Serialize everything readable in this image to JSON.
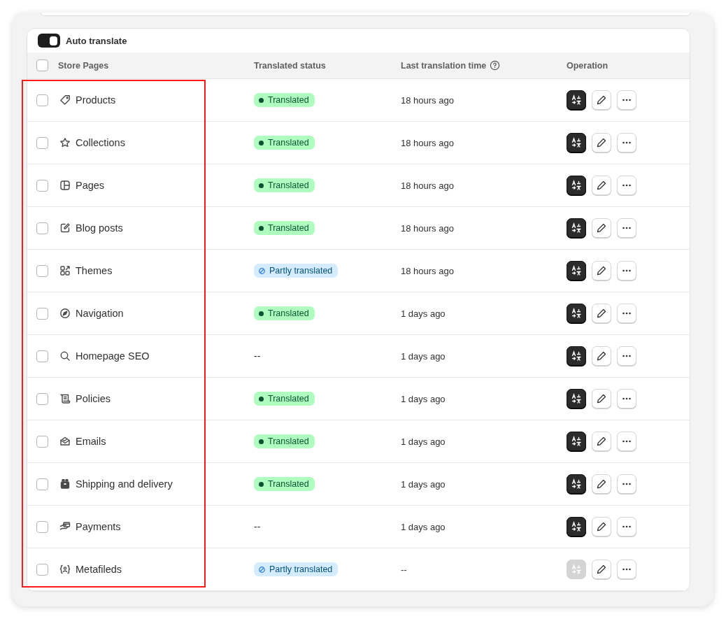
{
  "auto_translate": {
    "label": "Auto translate",
    "on": true
  },
  "table": {
    "columns": [
      "Store Pages",
      "Translated status",
      "Last translation time",
      "Operation"
    ],
    "header_checked": false,
    "rows": [
      {
        "kind": "tag",
        "name": "Products",
        "checked": false,
        "status": {
          "kind": "translated",
          "label": "Translated"
        },
        "time": "18 hours ago",
        "translate_enabled": true
      },
      {
        "kind": "star",
        "name": "Collections",
        "checked": false,
        "status": {
          "kind": "translated",
          "label": "Translated"
        },
        "time": "18 hours ago",
        "translate_enabled": true
      },
      {
        "kind": "layout",
        "name": "Pages",
        "checked": false,
        "status": {
          "kind": "translated",
          "label": "Translated"
        },
        "time": "18 hours ago",
        "translate_enabled": true
      },
      {
        "kind": "edit",
        "name": "Blog posts",
        "checked": false,
        "status": {
          "kind": "translated",
          "label": "Translated"
        },
        "time": "18 hours ago",
        "translate_enabled": true
      },
      {
        "kind": "apps",
        "name": "Themes",
        "checked": false,
        "status": {
          "kind": "partial",
          "label": "Partly translated"
        },
        "time": "18 hours ago",
        "translate_enabled": true
      },
      {
        "kind": "compass",
        "name": "Navigation",
        "checked": false,
        "status": {
          "kind": "translated",
          "label": "Translated"
        },
        "time": "1 days ago",
        "translate_enabled": true
      },
      {
        "kind": "search",
        "name": "Homepage SEO",
        "checked": false,
        "status": {
          "kind": "none",
          "label": "--"
        },
        "time": "1 days ago",
        "translate_enabled": true
      },
      {
        "kind": "scroll",
        "name": "Policies",
        "checked": false,
        "status": {
          "kind": "translated",
          "label": "Translated"
        },
        "time": "1 days ago",
        "translate_enabled": true
      },
      {
        "kind": "mail",
        "name": "Emails",
        "checked": false,
        "status": {
          "kind": "translated",
          "label": "Translated"
        },
        "time": "1 days ago",
        "translate_enabled": true
      },
      {
        "kind": "box",
        "name": "Shipping and delivery",
        "checked": false,
        "status": {
          "kind": "translated",
          "label": "Translated"
        },
        "time": "1 days ago",
        "translate_enabled": true
      },
      {
        "kind": "hand",
        "name": "Payments",
        "checked": false,
        "status": {
          "kind": "none",
          "label": "--"
        },
        "time": "1 days ago",
        "translate_enabled": true
      },
      {
        "kind": "metafield",
        "name": "Metafileds",
        "checked": false,
        "status": {
          "kind": "partial",
          "label": "Partly translated"
        },
        "time": "--",
        "translate_enabled": false
      }
    ]
  },
  "annotation": {
    "kind": "highlight-rectangle"
  }
}
